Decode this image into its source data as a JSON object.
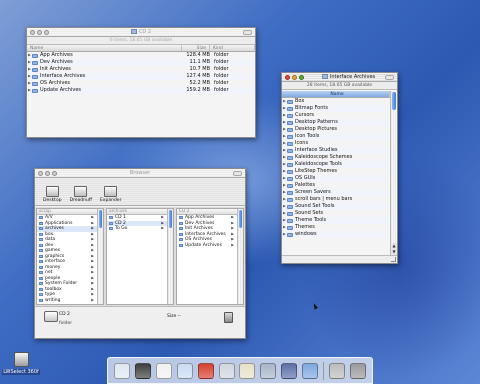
{
  "windows": {
    "cd2": {
      "title": "CD 2",
      "info": "6 items, 18.05 GB available",
      "headers": {
        "name": "Name",
        "size": "Size",
        "kind": "Kind"
      },
      "rows": [
        {
          "name": "App Archives",
          "size": "128.4 MB",
          "kind": "folder"
        },
        {
          "name": "Dev Archives",
          "size": "11.1 MB",
          "kind": "folder"
        },
        {
          "name": "Init Archives",
          "size": "10.7 MB",
          "kind": "folder"
        },
        {
          "name": "Interface Archives",
          "size": "127.4 MB",
          "kind": "folder"
        },
        {
          "name": "OS Archives",
          "size": "52.2 MB",
          "kind": "folder"
        },
        {
          "name": "Update Archives",
          "size": "159.2 MB",
          "kind": "folder"
        }
      ]
    },
    "interface_archives": {
      "title": "Interface Archives",
      "info": "28 items, 18.05 GB available",
      "headers": {
        "name": "Name"
      },
      "items": [
        "Box",
        "Bitmap Fonts",
        "Cursors",
        "Desktop Patterns",
        "Desktop Pictures",
        "Icon Tools",
        "Icons",
        "Interface Studies",
        "Kaleidoscope Schemes",
        "Kaleidoscope Tools",
        "LiteStep Themes",
        "OS GUIs",
        "Palettes",
        "Screen Savers",
        "scroll bars | menu bars",
        "Sound Set Tools",
        "Sound Sets",
        "Theme Tools",
        "Themes",
        "windows"
      ]
    },
    "browser": {
      "title": "Browser",
      "toolbar": [
        {
          "label": "Desktop",
          "icon": "desktop-icon"
        },
        {
          "label": "Dreadnuff",
          "icon": "drive-icon"
        },
        {
          "label": "Expander",
          "icon": "expander-icon"
        }
      ],
      "columns": [
        {
          "header": "scrap",
          "rows": [
            {
              "label": "A/V",
              "arrow": true
            },
            {
              "label": "Applications",
              "arrow": true
            },
            {
              "label": "archives",
              "arrow": true,
              "selected": true
            },
            {
              "label": "box",
              "arrow": true
            },
            {
              "label": "data",
              "arrow": true
            },
            {
              "label": "dev",
              "arrow": true
            },
            {
              "label": "games",
              "arrow": true
            },
            {
              "label": "graphics",
              "arrow": true
            },
            {
              "label": "interface",
              "arrow": true
            },
            {
              "label": "money",
              "arrow": true
            },
            {
              "label": "net",
              "arrow": true
            },
            {
              "label": "people",
              "arrow": true
            },
            {
              "label": "System Folder",
              "arrow": true
            },
            {
              "label": "toolbox",
              "arrow": true
            },
            {
              "label": "type",
              "arrow": true
            },
            {
              "label": "writing",
              "arrow": true
            }
          ]
        },
        {
          "header": "archives",
          "rows": [
            {
              "label": "CD 1",
              "arrow": true
            },
            {
              "label": "CD 2",
              "arrow": true,
              "selected": true
            },
            {
              "label": "To Go",
              "arrow": true
            }
          ]
        },
        {
          "header": "CD 2",
          "rows": [
            {
              "label": "App Archives",
              "arrow": true
            },
            {
              "label": "Dev Archives",
              "arrow": true
            },
            {
              "label": "Init Archives",
              "arrow": true
            },
            {
              "label": "Interface Archives",
              "arrow": true
            },
            {
              "label": "OS Archives",
              "arrow": true
            },
            {
              "label": "Update Archives",
              "arrow": true
            }
          ]
        }
      ],
      "footer": {
        "name": "CD 2",
        "kind": "folder",
        "size_label": "Size --"
      }
    }
  },
  "desktop_icon": {
    "label": "LWSelect 360f"
  },
  "dock_icons": [
    {
      "icon": "finder-icon",
      "color": "#dfe7f2"
    },
    {
      "icon": "monitor-icon",
      "color": "#3e3e3e"
    },
    {
      "icon": "document-icon",
      "color": "#f1f1f1"
    },
    {
      "icon": "mail-icon",
      "color": "#c9dbef"
    },
    {
      "icon": "paint-icon",
      "color": "#d6402f"
    },
    {
      "icon": "terminal-icon",
      "color": "#cfd6e0"
    },
    {
      "icon": "tool-icon",
      "color": "#e8e0c8"
    },
    {
      "icon": "system-icon",
      "color": "#a9b6c9"
    },
    {
      "icon": "disk-icon",
      "color": "#5c6fa8"
    },
    {
      "icon": "folder-icon",
      "color": "#7ea9e0"
    },
    {
      "icon": "gear-icon",
      "color": "#bcbcbc"
    },
    {
      "icon": "trash-icon",
      "color": "#9b9b9b"
    }
  ]
}
